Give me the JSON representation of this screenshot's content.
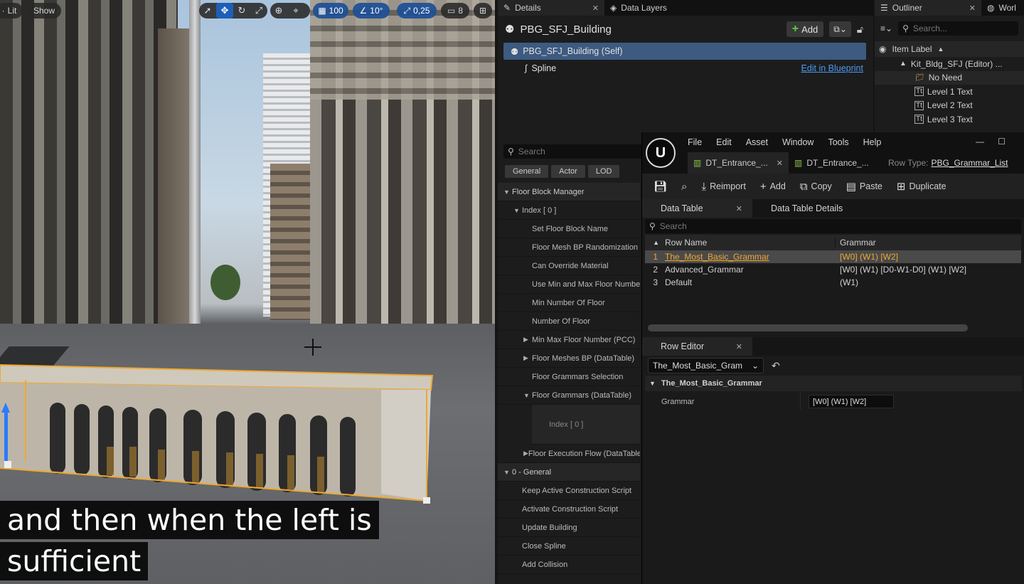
{
  "viewport": {
    "lit_label": "Lit",
    "show_label": "Show",
    "grid_snap": "100",
    "angle_snap": "10°",
    "scale_snap": "0,25",
    "camera_speed": "8",
    "subtitle_lines": [
      "and then when the left is",
      "sufficient"
    ]
  },
  "details": {
    "tab_details": "Details",
    "tab_data_layers": "Data Layers",
    "actor_name": "PBG_SFJ_Building",
    "add_label": "Add",
    "self_component": "PBG_SFJ_Building (Self)",
    "spline_component": "Spline",
    "edit_in_blueprint": "Edit in Blueprint",
    "search_placeholder": "Search",
    "categories": [
      "General",
      "Actor",
      "LOD"
    ],
    "props": [
      {
        "label": "Floor Block Manager",
        "indent": 0,
        "arrow": "▼",
        "cat": true
      },
      {
        "label": "Index [ 0 ]",
        "indent": 1,
        "arrow": "▼"
      },
      {
        "label": "Set Floor Block Name",
        "indent": 2,
        "arrow": ""
      },
      {
        "label": "Floor Mesh BP Randomization",
        "indent": 2,
        "arrow": ""
      },
      {
        "label": "Can Override Material",
        "indent": 2,
        "arrow": ""
      },
      {
        "label": "Use Min and Max Floor Number",
        "indent": 2,
        "arrow": ""
      },
      {
        "label": "Min Number Of Floor",
        "indent": 2,
        "arrow": ""
      },
      {
        "label": "Number Of Floor",
        "indent": 2,
        "arrow": ""
      },
      {
        "label": "Min Max Floor Number (PCC)",
        "indent": 2,
        "arrow": "▶"
      },
      {
        "label": "Floor Meshes BP (DataTable)",
        "indent": 2,
        "arrow": "▶"
      },
      {
        "label": "Floor Grammars Selection",
        "indent": 2,
        "arrow": ""
      },
      {
        "label": "Floor Grammars (DataTable)",
        "indent": 2,
        "arrow": "▼"
      },
      {
        "label": "Index [ 0 ]",
        "indent": 3,
        "arrow": "",
        "tall": true
      },
      {
        "label": "Floor Execution Flow (DataTable)",
        "indent": 2,
        "arrow": "▶"
      },
      {
        "label": "0 - General",
        "indent": 0,
        "arrow": "▼",
        "cat": true
      },
      {
        "label": "Keep Active Construction Script",
        "indent": 1,
        "arrow": ""
      },
      {
        "label": "Activate Construction Script",
        "indent": 1,
        "arrow": ""
      },
      {
        "label": "Update Building",
        "indent": 1,
        "arrow": ""
      },
      {
        "label": "Close Spline",
        "indent": 1,
        "arrow": ""
      },
      {
        "label": "Add Collision",
        "indent": 1,
        "arrow": ""
      }
    ]
  },
  "outliner": {
    "tab_outliner": "Outliner",
    "tab_world": "Worl",
    "search_placeholder": "Search...",
    "item_label_header": "Item Label",
    "items": [
      {
        "label": "Kit_Bldg_SFJ (Editor) ...",
        "indent": 1,
        "icon": "level-icon"
      },
      {
        "label": "No Need",
        "indent": 2,
        "icon": "folder-icon"
      },
      {
        "label": "Level 1 Text",
        "indent": 2,
        "icon": "text-actor-icon"
      },
      {
        "label": "Level 2 Text",
        "indent": 2,
        "icon": "text-actor-icon"
      },
      {
        "label": "Level 3 Text",
        "indent": 2,
        "icon": "text-actor-icon"
      }
    ]
  },
  "datatable": {
    "menus": [
      "File",
      "Edit",
      "Asset",
      "Window",
      "Tools",
      "Help"
    ],
    "tab1": "DT_Entrance_...",
    "tab2": "DT_Entrance_...",
    "row_type_label": "Row Type:",
    "row_type_value": "PBG_Grammar_List",
    "toolbar": [
      "Reimport",
      "Add",
      "Copy",
      "Paste",
      "Duplicate"
    ],
    "subtab_table": "Data Table",
    "subtab_details": "Data Table Details",
    "search_placeholder": "Search",
    "col_row_name": "Row Name",
    "col_grammar": "Grammar",
    "rows": [
      {
        "idx": "1",
        "name": "The_Most_Basic_Grammar",
        "grammar": "[W0] (W1) [W2]"
      },
      {
        "idx": "2",
        "name": "Advanced_Grammar",
        "grammar": "[W0] (W1) [D0-W1-D0] (W1) [W2]"
      },
      {
        "idx": "3",
        "name": "Default",
        "grammar": "(W1)"
      }
    ],
    "row_editor_tab": "Row Editor",
    "row_select_value": "The_Most_Basic_Gram",
    "section_title": "The_Most_Basic_Grammar",
    "field_label": "Grammar",
    "field_value": "[W0] (W1) [W2]"
  }
}
